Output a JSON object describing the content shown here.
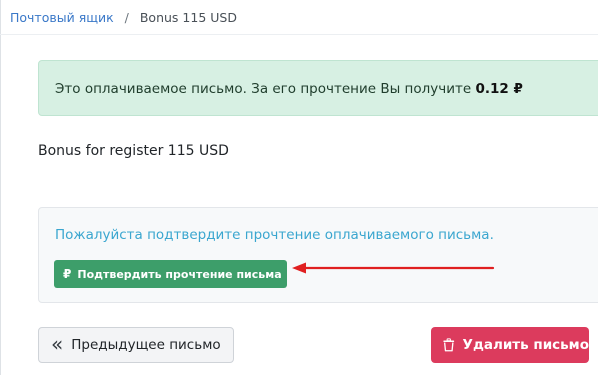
{
  "breadcrumb": {
    "mailbox_label": "Почтовый ящик",
    "separator": "/",
    "current": "Bonus 115 USD"
  },
  "paid_notice": {
    "text": "Это оплачиваемое письмо. За его прочтение Вы получите",
    "reward": "0.12 ₽"
  },
  "message": {
    "body": "Bonus for register 115 USD"
  },
  "confirm": {
    "prompt": "Пожалуйста подтвердите прочтение оплачиваемого письма.",
    "button_label": "Подтвердить прочтение письма",
    "button_icon": "ruble-icon"
  },
  "actions": {
    "prev_label": "Предыдущее письмо",
    "prev_icon": "double-chevron-left-icon",
    "delete_label": "Удалить письмо",
    "delete_icon": "trash-icon"
  },
  "colors": {
    "link": "#3a78c8",
    "alert_bg": "#d7f0e3",
    "confirm_text": "#3aa6cf",
    "confirm_button": "#3d9e6a",
    "delete_button": "#dc3b5d",
    "annotation_arrow": "#e02020"
  }
}
